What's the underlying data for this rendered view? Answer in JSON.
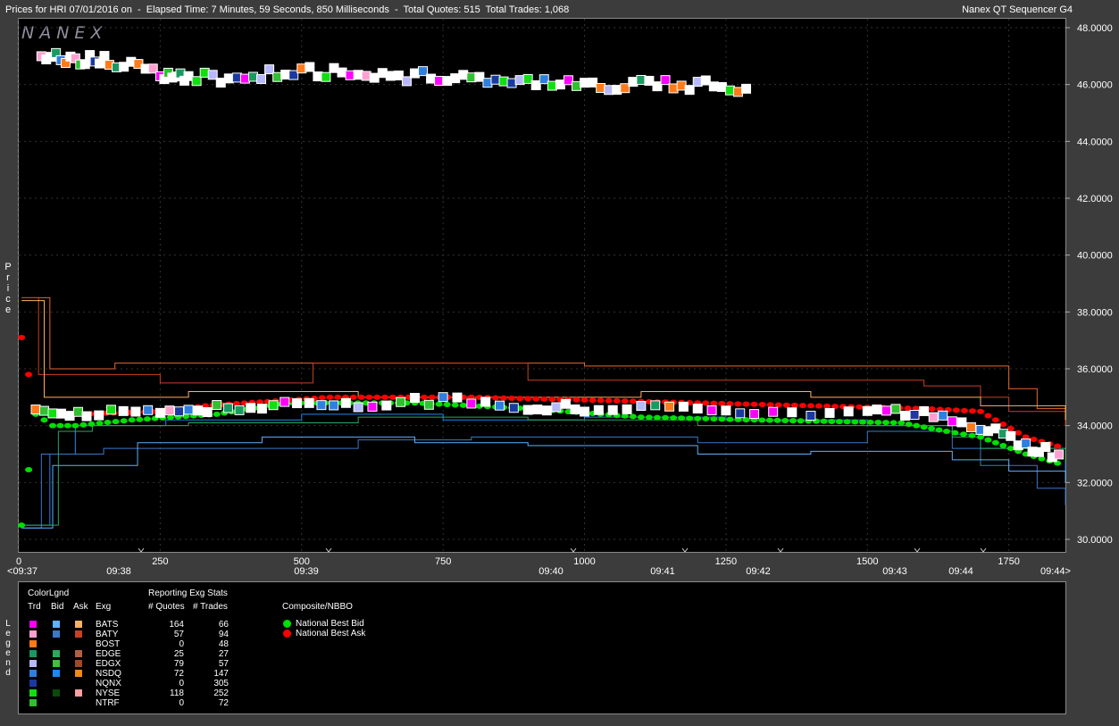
{
  "header": {
    "title": "Prices for HRI 07/01/2016 on  -  Elapsed Time: 7 Minutes, 59 Seconds, 850 Milliseconds  -  Total Quotes: 515  Total Trades: 1,068",
    "app_name": "Nanex QT Sequencer G4"
  },
  "logo_text": "NANEX",
  "y_axis_label": "Price",
  "legend_side_label": "Legend",
  "colors": {
    "background": "#000000",
    "national_best_bid": "#00e000",
    "national_best_ask": "#ff0000"
  },
  "chart_data": {
    "type": "scatter",
    "ylim": [
      30.0,
      48.0
    ],
    "xlim": [
      0,
      1850
    ],
    "y_ticks": [
      "48.0000",
      "46.0000",
      "44.0000",
      "42.0000",
      "40.0000",
      "38.0000",
      "36.0000",
      "34.0000",
      "32.0000",
      "30.0000"
    ],
    "x_ticks": [
      "0",
      "250",
      "500",
      "750",
      "1000",
      "1250",
      "1500",
      "1750"
    ],
    "time_labels": [
      "<09:37",
      "09:38",
      "09:39",
      "09:40",
      "09:41",
      "09:42",
      "09:43",
      "09:44",
      "09:44>"
    ],
    "series": [
      {
        "name": "National Best Bid",
        "color": "#00e000",
        "points": [
          [
            5,
            30.5
          ],
          [
            30,
            34.4
          ],
          [
            60,
            34.0
          ],
          [
            100,
            34.0
          ],
          [
            200,
            34.2
          ],
          [
            350,
            34.4
          ],
          [
            470,
            34.8
          ],
          [
            700,
            34.8
          ],
          [
            900,
            34.6
          ],
          [
            1100,
            34.3
          ],
          [
            1300,
            34.2
          ],
          [
            1560,
            34.1
          ],
          [
            1640,
            33.8
          ],
          [
            1700,
            33.6
          ],
          [
            1780,
            33.0
          ],
          [
            1850,
            32.6
          ]
        ]
      },
      {
        "name": "National Best Ask",
        "color": "#ff0000",
        "points": [
          [
            5,
            37.1
          ],
          [
            30,
            34.5
          ],
          [
            100,
            34.4
          ],
          [
            250,
            34.5
          ],
          [
            330,
            34.7
          ],
          [
            550,
            35.0
          ],
          [
            800,
            35.0
          ],
          [
            1000,
            34.9
          ],
          [
            1200,
            34.8
          ],
          [
            1400,
            34.7
          ],
          [
            1600,
            34.6
          ],
          [
            1700,
            34.5
          ],
          [
            1780,
            33.6
          ],
          [
            1850,
            33.2
          ]
        ]
      }
    ],
    "legend": {
      "title": "ColorLgnd",
      "columns": [
        "Trd",
        "Bid",
        "Ask",
        "Exg"
      ],
      "stats_title": "Reporting Exg Stats",
      "stats_columns": [
        "# Quotes",
        "# Trades"
      ],
      "nbbo_title": "Composite/NBBO",
      "nbbo_items": [
        "National Best Bid",
        "National Best Ask"
      ],
      "rows": [
        {
          "exg": "BATS",
          "quotes": "164",
          "trades": "66",
          "trd": "#ff00ff",
          "bid": "#5fb0ff",
          "ask": "#ffb060"
        },
        {
          "exg": "BATY",
          "quotes": "57",
          "trades": "94",
          "trd": "#ff9fd0",
          "bid": "#3b78c8",
          "ask": "#c84020"
        },
        {
          "exg": "BOST",
          "quotes": "0",
          "trades": "48",
          "trd": "#ff7a1a",
          "bid": "",
          "ask": ""
        },
        {
          "exg": "EDGE",
          "quotes": "25",
          "trades": "27",
          "trd": "#1a9a60",
          "bid": "#2aa860",
          "ask": "#b06040"
        },
        {
          "exg": "EDGX",
          "quotes": "79",
          "trades": "57",
          "trd": "#b8b8ff",
          "bid": "#40c040",
          "ask": "#a04828"
        },
        {
          "exg": "NSDQ",
          "quotes": "72",
          "trades": "147",
          "trd": "#2d7fe0",
          "bid": "#1a8af0",
          "ask": "#f08a10"
        },
        {
          "exg": "NQNX",
          "quotes": "0",
          "trades": "305",
          "trd": "#1a3aa0",
          "bid": "",
          "ask": ""
        },
        {
          "exg": "NYSE",
          "quotes": "118",
          "trades": "252",
          "trd": "#10e010",
          "bid": "#0a4a0a",
          "ask": "#ffa0a0"
        },
        {
          "exg": "NTRF",
          "quotes": "0",
          "trades": "72",
          "trd": "#30c030",
          "bid": "",
          "ask": ""
        }
      ]
    }
  }
}
